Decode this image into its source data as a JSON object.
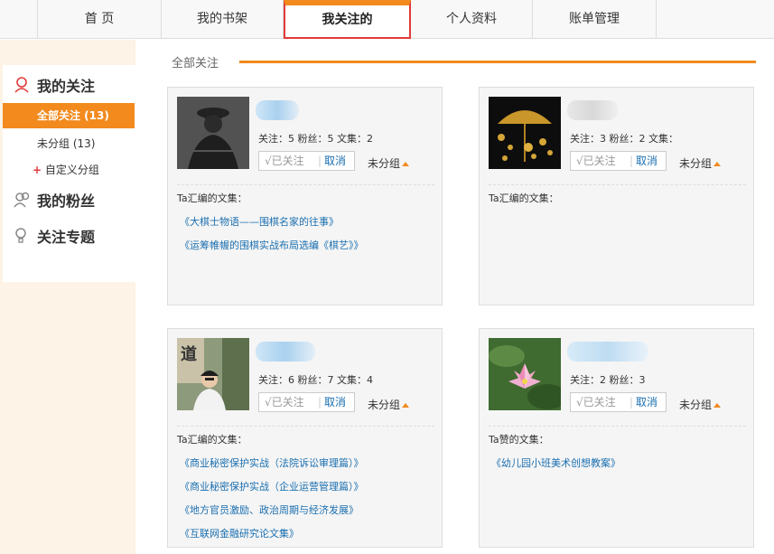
{
  "nav": {
    "tabs": [
      "首 页",
      "我的书架",
      "我关注的",
      "个人资料",
      "账单管理"
    ],
    "active_index": 2
  },
  "sidebar": {
    "follow_heading": "我的关注",
    "selected": "全部关注 (13)",
    "ungrouped": "未分组 (13)",
    "custom_group": "自定义分组",
    "custom_plus": "+",
    "fans_heading": "我的粉丝",
    "topics_heading": "关注专题"
  },
  "main": {
    "title": "全部关注"
  },
  "cards": [
    {
      "stats": "关注：5  粉丝：5  文集：2",
      "followed": "√已关注",
      "cancel": "取消",
      "sep": "|",
      "group": "未分组",
      "collections_label": "Ta汇编的文集：",
      "links": [
        "《大棋士物语——围棋名家的往事》",
        "《运筹帷幄的围棋实战布局选编《棋艺》》"
      ]
    },
    {
      "stats": "关注：3  粉丝：2  文集：",
      "followed": "√已关注",
      "cancel": "取消",
      "sep": "|",
      "group": "未分组",
      "collections_label": "Ta汇编的文集：",
      "links": []
    },
    {
      "stats": "关注：6  粉丝：7  文集：4",
      "followed": "√已关注",
      "cancel": "取消",
      "sep": "|",
      "group": "未分组",
      "collections_label": "Ta汇编的文集：",
      "links": [
        "《商业秘密保护实战（法院诉讼审理篇）》",
        "《商业秘密保护实战（企业运营管理篇）》",
        "《地方官员激励、政治周期与经济发展》",
        "《互联网金融研究论文集》"
      ]
    },
    {
      "stats": "关注：2  粉丝：3",
      "followed": "√已关注",
      "cancel": "取消",
      "sep": "|",
      "group": "未分组",
      "collections_label": "Ta赞的文集：",
      "links": [
        "《幼儿园小班美术创想教案》"
      ]
    }
  ],
  "avatar3_sign": "道",
  "colors": {
    "accent": "#f28a1e",
    "active_border": "#e03a3a",
    "link": "#1a6fb0",
    "sidebar_bg": "#fdf3e6"
  }
}
